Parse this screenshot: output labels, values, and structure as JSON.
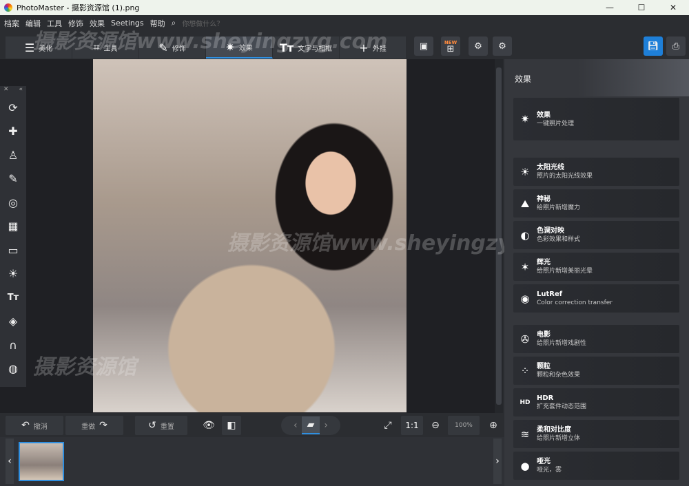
{
  "window": {
    "title": "PhotoMaster - 摄影资源馆 (1).png",
    "minimize": "—",
    "maximize": "☐",
    "close": "✕"
  },
  "menu": {
    "items": [
      "档案",
      "编辑",
      "工具",
      "修饰",
      "效果",
      "Seetings",
      "帮助"
    ],
    "search_placeholder": "你想做什么？"
  },
  "tabs": [
    {
      "label": "美化",
      "icon": "sliders-icon"
    },
    {
      "label": "工具",
      "icon": "crop-icon"
    },
    {
      "label": "修饰",
      "icon": "brush-icon"
    },
    {
      "label": "效果",
      "icon": "magic-wand-icon",
      "active": true
    },
    {
      "label": "文字与相框",
      "icon": "text-icon"
    },
    {
      "label": "外挂",
      "icon": "plus-icon"
    }
  ],
  "toolbar_badge": "NEW",
  "left_panel": {
    "close": "✕",
    "collapse": "«"
  },
  "right_panel": {
    "title": "效果",
    "header_card": {
      "title": "效果",
      "subtitle": "一键照片处理"
    },
    "cards": [
      {
        "title": "太阳光线",
        "subtitle": "照片的太阳光线效果",
        "icon": "sun-icon"
      },
      {
        "title": "神秘",
        "subtitle": "给照片新增魔力",
        "icon": "mystic-icon"
      },
      {
        "title": "色调对映",
        "subtitle": "色彩效果和样式",
        "icon": "contrast-icon"
      },
      {
        "title": "辉光",
        "subtitle": "给照片新增美丽光晕",
        "icon": "glow-wand-icon"
      },
      {
        "title": "LutRef",
        "subtitle": "Color correction transfer",
        "icon": "lut-icon"
      },
      {
        "title": "电影",
        "subtitle": "给照片新增戏剧性",
        "icon": "film-reel-icon"
      },
      {
        "title": "颗粒",
        "subtitle": "颗粒和杂色效果",
        "icon": "grain-icon"
      },
      {
        "title": "HDR",
        "subtitle": "扩充套件动态范围",
        "icon": "hdr-icon"
      },
      {
        "title": "柔和对比度",
        "subtitle": "给照片新增立体",
        "icon": "soft-contrast-icon"
      },
      {
        "title": "哑光",
        "subtitle": "哑光，雾",
        "icon": "drop-icon"
      }
    ]
  },
  "bottom": {
    "undo": "撤消",
    "redo": "重做",
    "reset": "重置",
    "ratio": "1:1",
    "zoom": "100%"
  },
  "watermark": {
    "text1": "摄影资源馆www.sheyingzyg.com",
    "text2": "摄影资源馆www.sheyingzyg.com",
    "text3": "摄影资源馆"
  },
  "colors": {
    "accent": "#2f8fe0",
    "bg": "#2b2d31"
  }
}
